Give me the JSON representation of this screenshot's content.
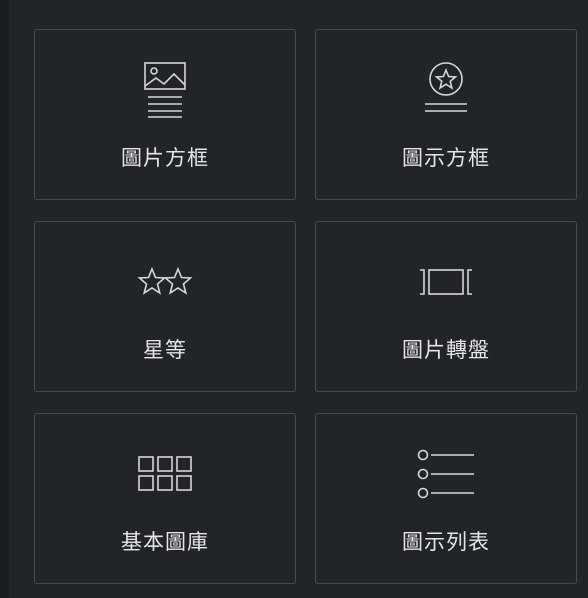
{
  "widgets": [
    {
      "label": "圖片方框",
      "icon": "image-box-icon"
    },
    {
      "label": "圖示方框",
      "icon": "icon-box-icon"
    },
    {
      "label": "星等",
      "icon": "star-rating-icon"
    },
    {
      "label": "圖片轉盤",
      "icon": "image-carousel-icon"
    },
    {
      "label": "基本圖庫",
      "icon": "basic-gallery-icon"
    },
    {
      "label": "圖示列表",
      "icon": "icon-list-icon"
    }
  ],
  "colors": {
    "background": "#232427",
    "border": "#484a4f",
    "text": "#e4e5e7",
    "icon": "#d5d6d8"
  }
}
